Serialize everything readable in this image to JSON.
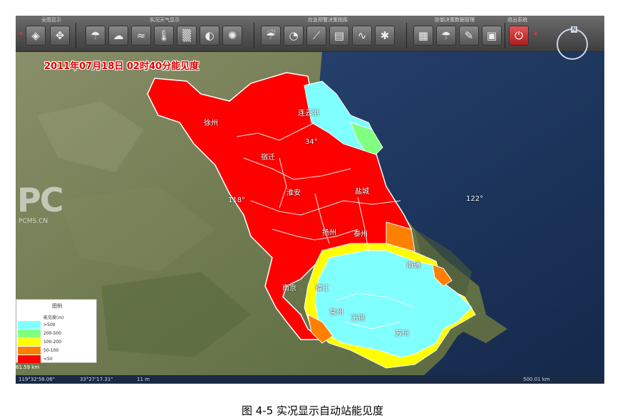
{
  "toolbar": {
    "groups": [
      {
        "label": "全图显示"
      },
      {
        "label": "实况天气显示"
      },
      {
        "label": "应急预警决策指挥"
      },
      {
        "label": "防御决策数据管理"
      },
      {
        "label": "退出系统"
      }
    ],
    "buttons": [
      {
        "icon": "layers-icon",
        "glyph": "◈"
      },
      {
        "icon": "map-pan-icon",
        "glyph": "✥"
      },
      {
        "icon": "weather-station-icon",
        "glyph": "☂"
      },
      {
        "icon": "cloud-icon",
        "glyph": "☁"
      },
      {
        "icon": "wind-icon",
        "glyph": "≈"
      },
      {
        "icon": "thermometer-icon",
        "glyph": "🌡"
      },
      {
        "icon": "fog-icon",
        "glyph": "▒"
      },
      {
        "icon": "globe-icon",
        "glyph": "◐"
      },
      {
        "icon": "typhoon-icon",
        "glyph": "✺"
      },
      {
        "icon": "rain-cloud-icon",
        "glyph": "☔"
      },
      {
        "icon": "pie-chart-icon",
        "glyph": "◔"
      },
      {
        "icon": "line-chart-icon",
        "glyph": "⟋"
      },
      {
        "icon": "document-icon",
        "glyph": "▤"
      },
      {
        "icon": "wave-chart-icon",
        "glyph": "∿"
      },
      {
        "icon": "gear-icon",
        "glyph": "✱"
      },
      {
        "icon": "table-icon",
        "glyph": "▦"
      },
      {
        "icon": "umbrella-icon",
        "glyph": "☂"
      },
      {
        "icon": "notebook-icon",
        "glyph": "✎"
      },
      {
        "icon": "calendar-icon",
        "glyph": "▣"
      },
      {
        "icon": "power-icon",
        "glyph": "⏻"
      }
    ]
  },
  "map": {
    "datetime": "2011年07月18日 02时40分能见度",
    "cities": [
      "徐州",
      "连云港",
      "宿迁",
      "淮安",
      "盐城",
      "扬州",
      "泰州",
      "南通",
      "南京",
      "镇江",
      "常州",
      "无锡",
      "苏州"
    ],
    "coords": [
      "34°",
      "118°",
      "122°"
    ],
    "watermark": "PC",
    "watermark_sub": "PCMS.CN"
  },
  "legend": {
    "title": "图例",
    "unit": "能见度(m)",
    "items": [
      {
        "label": ">500",
        "color": "#80ffff"
      },
      {
        "label": "200-500",
        "color": "#80ff80"
      },
      {
        "label": "100-200",
        "color": "#ffff00"
      },
      {
        "label": "50-100",
        "color": "#ff8000"
      },
      {
        "label": "<50",
        "color": "#ff0000"
      }
    ]
  },
  "statusbar": {
    "scale": "61.59 km",
    "lon": "119°32'58.06\"",
    "lat": "33°27'17.31\"",
    "elev": "11 m",
    "eye": "500.01 km"
  },
  "caption": "图 4-5  实况显示自动站能见度"
}
